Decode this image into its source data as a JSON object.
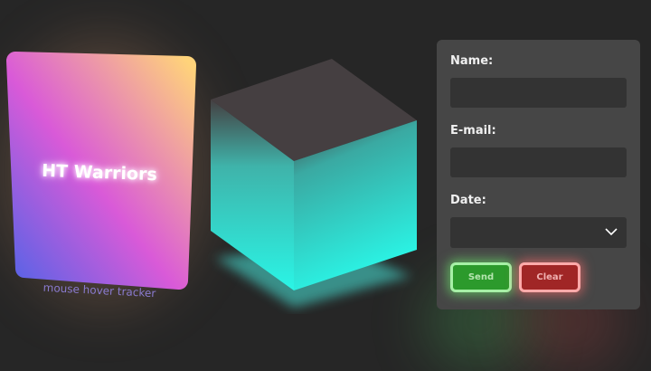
{
  "card": {
    "title": "HT Warriors",
    "caption": "mouse hover tracker",
    "gradient": [
      "#ffd37a",
      "#d95ad8",
      "#5a63e6"
    ]
  },
  "cube": {
    "color": "#2af5e6",
    "top_color": "#453f41"
  },
  "form": {
    "name_label": "Name:",
    "name_value": "",
    "email_label": "E-mail:",
    "email_value": "",
    "date_label": "Date:",
    "date_value": "",
    "send_label": "Send",
    "clear_label": "Clear"
  },
  "icons": {
    "select_arrow": "chevron-down-icon"
  }
}
